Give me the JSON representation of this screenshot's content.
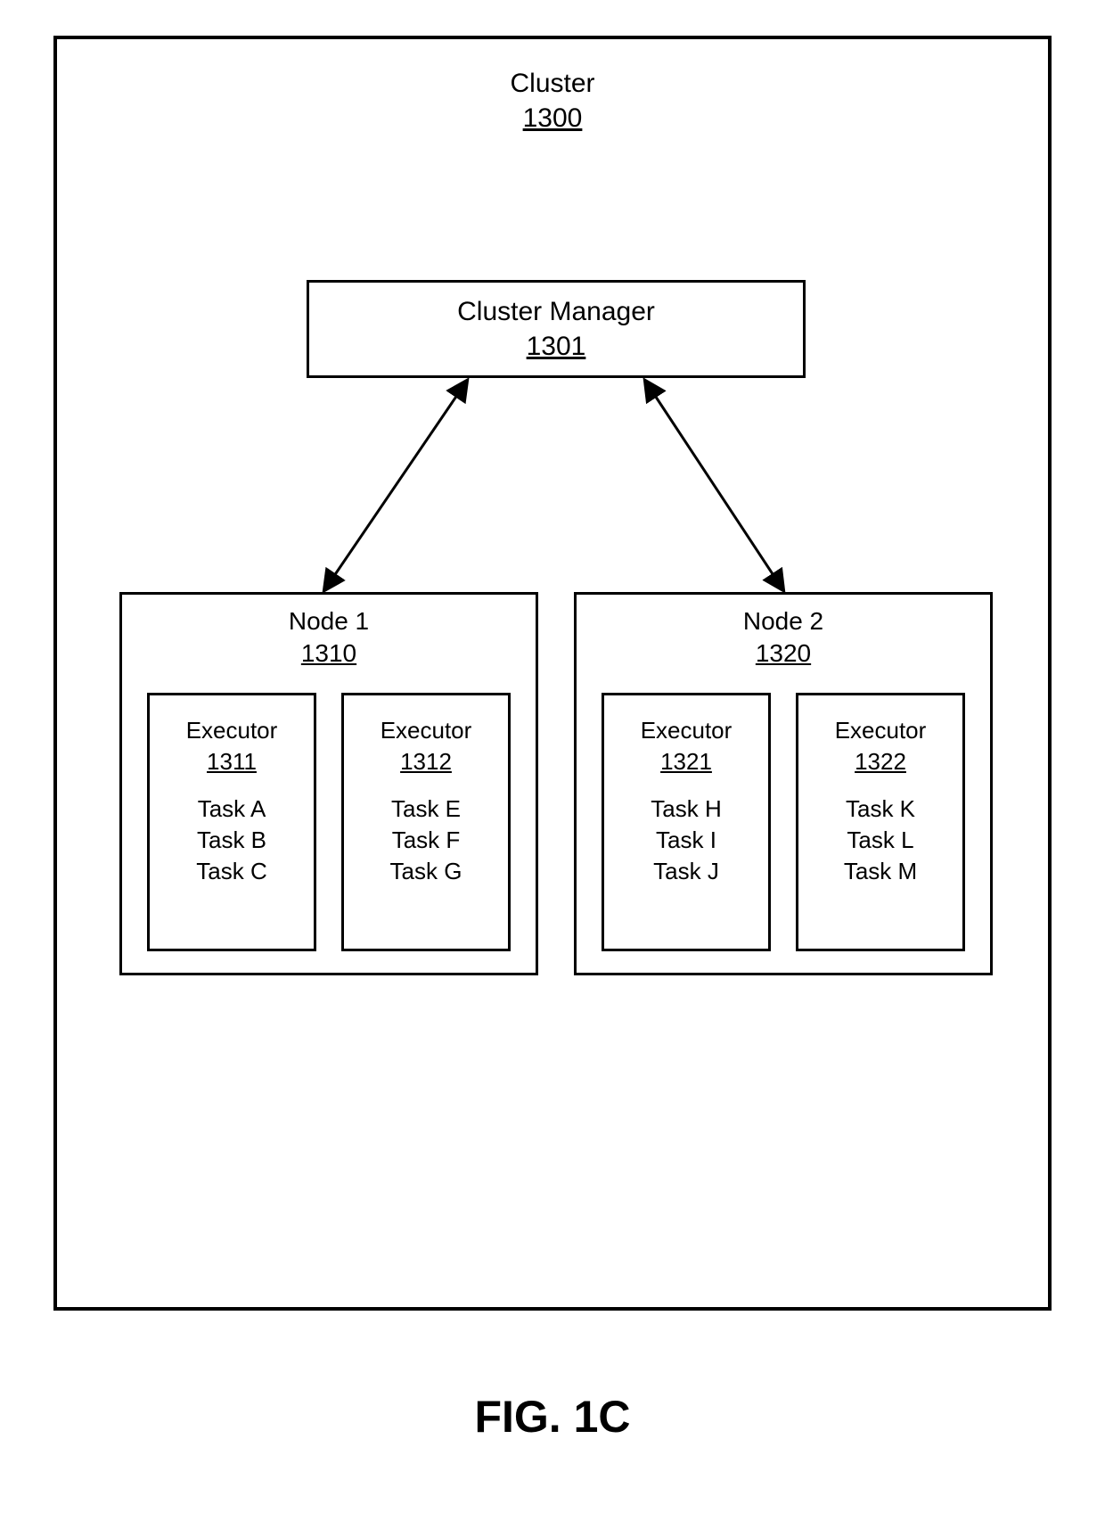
{
  "cluster": {
    "label": "Cluster",
    "ref": "1300"
  },
  "manager": {
    "label": "Cluster Manager",
    "ref": "1301"
  },
  "nodes": [
    {
      "label": "Node 1",
      "ref": "1310",
      "executors": [
        {
          "label": "Executor",
          "ref": "1311",
          "tasks": [
            "Task A",
            "Task B",
            "Task C"
          ]
        },
        {
          "label": "Executor",
          "ref": "1312",
          "tasks": [
            "Task E",
            "Task F",
            "Task G"
          ]
        }
      ]
    },
    {
      "label": "Node 2",
      "ref": "1320",
      "executors": [
        {
          "label": "Executor",
          "ref": "1321",
          "tasks": [
            "Task H",
            "Task I",
            "Task J"
          ]
        },
        {
          "label": "Executor",
          "ref": "1322",
          "tasks": [
            "Task K",
            "Task L",
            "Task M"
          ]
        }
      ]
    }
  ],
  "figure_caption": "FIG. 1C"
}
